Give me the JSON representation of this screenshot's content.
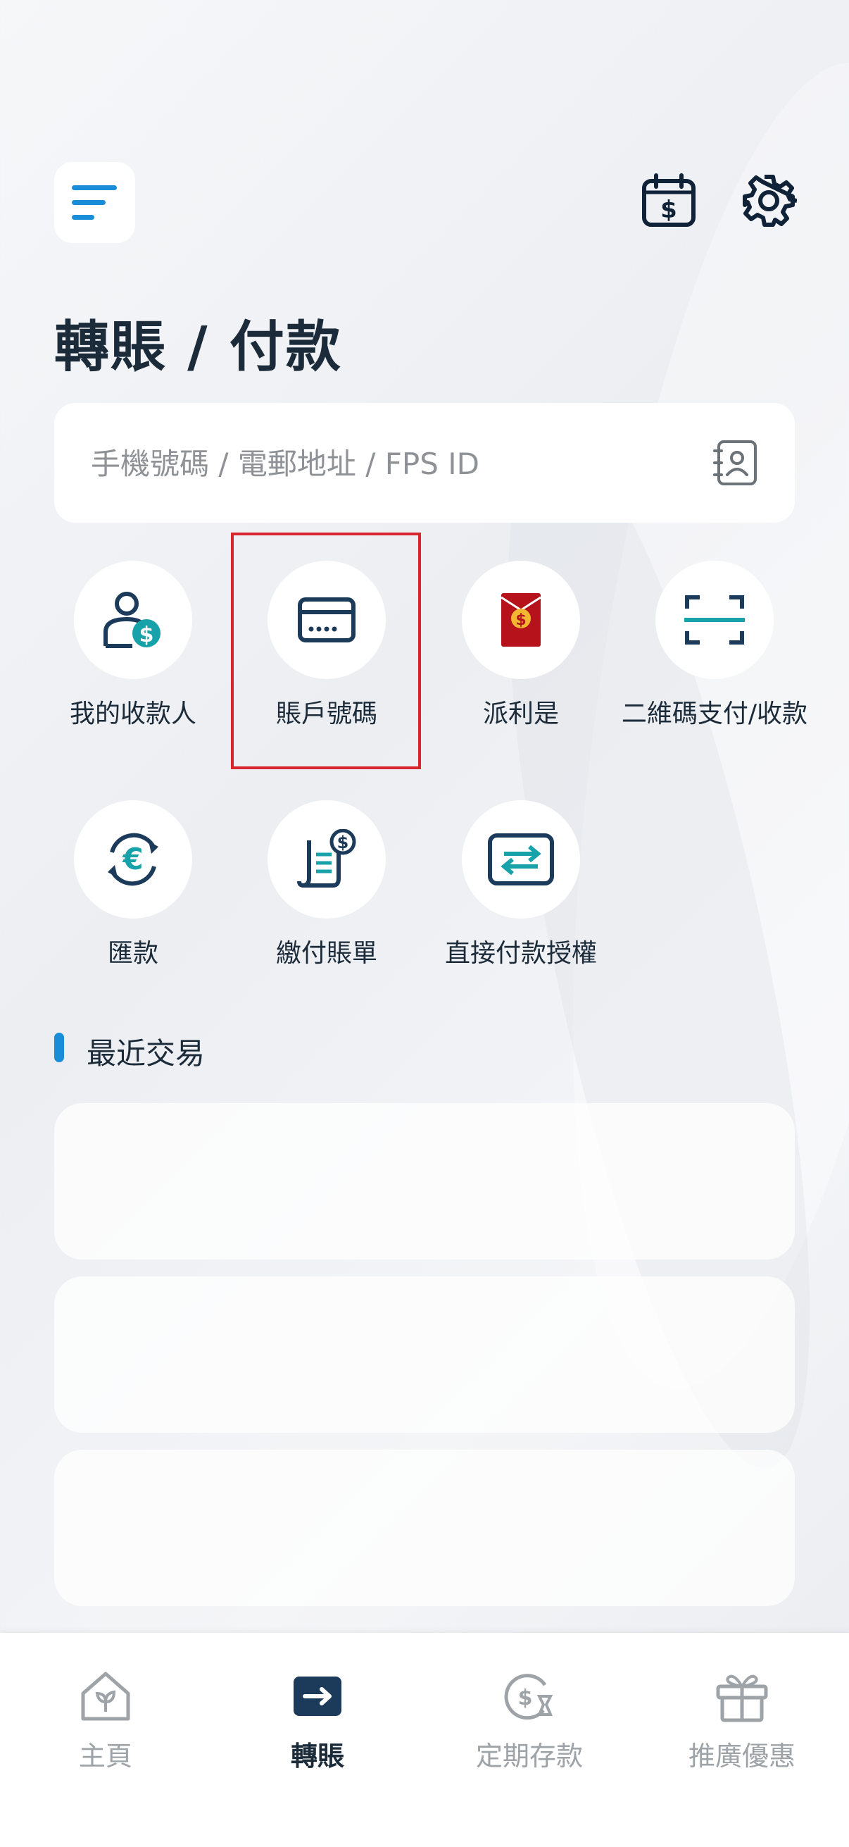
{
  "page_title": "轉賬 / 付款",
  "search": {
    "placeholder": "手機號碼 / 電郵地址 / FPS ID"
  },
  "actions": [
    {
      "label": "我的收款人",
      "icon": "payee-person-dollar-icon"
    },
    {
      "label": "賬戶號碼",
      "icon": "card-icon"
    },
    {
      "label": "派利是",
      "icon": "red-packet-icon"
    },
    {
      "label": "二維碼支付/收款",
      "icon": "qr-scan-icon"
    },
    {
      "label": "匯款",
      "icon": "euro-exchange-icon"
    },
    {
      "label": "繳付賬單",
      "icon": "bill-receipt-icon"
    },
    {
      "label": "直接付款授權",
      "icon": "transfer-arrows-icon"
    }
  ],
  "recent": {
    "title": "最近交易"
  },
  "tabs": [
    {
      "label": "主頁",
      "icon": "home-leaf-icon",
      "active": false
    },
    {
      "label": "轉賬",
      "icon": "transfer-arrow-icon",
      "active": true
    },
    {
      "label": "定期存款",
      "icon": "time-deposit-icon",
      "active": false
    },
    {
      "label": "推廣優惠",
      "icon": "gift-icon",
      "active": false
    }
  ],
  "colors": {
    "navy": "#1c3a5a",
    "teal": "#16a2a8",
    "red": "#b5121b",
    "gold": "#f2b632",
    "accent_blue": "#1a8dd8",
    "highlight_red": "#d8242c"
  }
}
